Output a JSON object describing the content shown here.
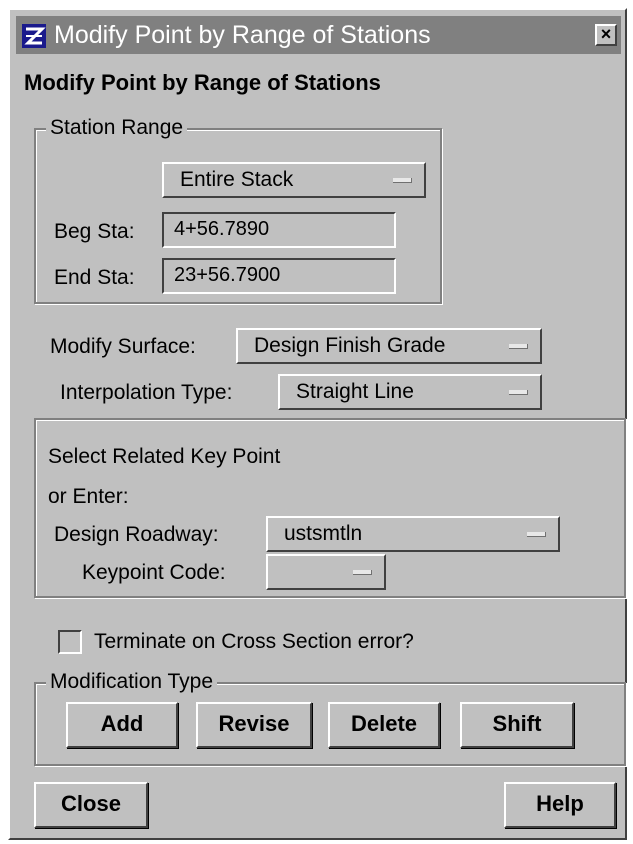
{
  "window": {
    "title": "Modify Point by Range of Stations",
    "close_glyph": "×",
    "app_icon": "microstation-icon"
  },
  "heading": "Modify Point by Range of Stations",
  "station_range": {
    "legend": "Station Range",
    "selection": "Entire Stack",
    "beg_label": "Beg Sta:",
    "beg_value": "4+56.7890",
    "end_label": "End Sta:",
    "end_value": "23+56.7900"
  },
  "modify_surface": {
    "label": "Modify Surface:",
    "value": "Design Finish Grade"
  },
  "interpolation": {
    "label": "Interpolation Type:",
    "value": "Straight Line"
  },
  "key_point": {
    "line1": "Select Related Key Point",
    "line2": "or Enter:",
    "roadway_label": "Design Roadway:",
    "roadway_value": "ustsmtln",
    "code_label": "Keypoint Code:",
    "code_value": ""
  },
  "terminate": {
    "label": "Terminate on Cross Section error?",
    "checked": false
  },
  "modification": {
    "legend": "Modification Type",
    "add": "Add",
    "revise": "Revise",
    "delete": "Delete",
    "shift": "Shift"
  },
  "footer": {
    "close": "Close",
    "help": "Help"
  }
}
